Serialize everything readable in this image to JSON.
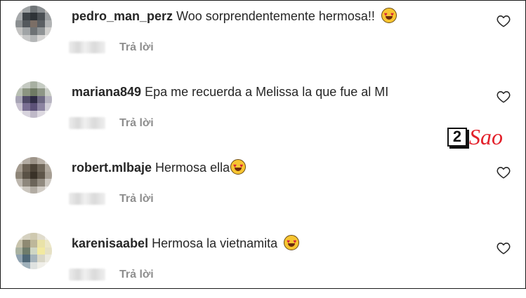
{
  "comments": [
    {
      "username": "pedro_man_perz",
      "text": "Woo sorprendentemente hermosa!!",
      "emoji": "heart-eyes-emoji",
      "reply_label": "Trả lời",
      "avatar_colors": [
        "#c9c6c4",
        "#9fa3a5",
        "#6f7477",
        "#8b8f92",
        "#bdbbb9",
        "#a6a9ab",
        "#3f4448",
        "#2f3438",
        "#4b5054",
        "#9c9fa1",
        "#8a8e90",
        "#54595d",
        "#7b6e66",
        "#5b5f63",
        "#b1b3b4",
        "#c3c3c2",
        "#a0a4a6",
        "#6e7275",
        "#8f9395",
        "#d2d1cf",
        "#e4e3e1",
        "#c7c8c8",
        "#b4b6b7",
        "#d6d5d4",
        "#ebeae8"
      ]
    },
    {
      "username": "mariana849",
      "text": "Epa me recuerda a Melissa la que fue al MI",
      "emoji": "",
      "reply_label": "Trả lời",
      "avatar_colors": [
        "#dadcd9",
        "#c5cac2",
        "#a8b0a2",
        "#c6ccc3",
        "#e6e7e5",
        "#b9c0b3",
        "#8c9581",
        "#6f7a64",
        "#8e9686",
        "#c9cdc5",
        "#a7a4b5",
        "#4f4a66",
        "#2e2b44",
        "#6d6882",
        "#b7b4c1",
        "#c8c2d0",
        "#7a6f93",
        "#5c5178",
        "#8c84a1",
        "#d2cfd8",
        "#eeeeee",
        "#d7d3dd",
        "#bfb9c8",
        "#dcd8e0",
        "#f1f1f1"
      ]
    },
    {
      "username": "robert.mlbaje",
      "text": "Hermosa ella",
      "emoji": "heart-eyes-emoji",
      "reply_label": "Trả lời",
      "avatar_colors": [
        "#d8d4cf",
        "#b3aca3",
        "#9d9489",
        "#b8b0a6",
        "#dcd8d3",
        "#a39a8e",
        "#6b6154",
        "#4d4438",
        "#6f6659",
        "#b0a89d",
        "#8d8578",
        "#5a5246",
        "#3a3228",
        "#5e5549",
        "#a69e93",
        "#bdb7ae",
        "#8e877c",
        "#6c655a",
        "#918a7f",
        "#cdc8c1",
        "#e6e3df",
        "#cbc6be",
        "#b2aca3",
        "#d1ccc5",
        "#ece9e6"
      ]
    },
    {
      "username": "karenisaabel",
      "text": "Hermosa la vietnamita",
      "emoji": "heart-eyes-emoji",
      "reply_label": "Trả lời",
      "avatar_colors": [
        "#e7e4d9",
        "#d5d1c0",
        "#cfc9b0",
        "#e0dccc",
        "#f0eee7",
        "#c9c4ad",
        "#8f8a73",
        "#bdb79a",
        "#e9e2a8",
        "#ece7c8",
        "#a9b2a1",
        "#6f7c6b",
        "#cfd6c4",
        "#f2e9a0",
        "#e6e1c4",
        "#8fa2b0",
        "#4f6877",
        "#a5b3bb",
        "#d9d7c7",
        "#ebe9de",
        "#c6cdd1",
        "#9fb0ba",
        "#dfe2e0",
        "#f0efe9",
        "#f7f6f2"
      ]
    }
  ],
  "watermark": {
    "number": "2",
    "text": "Sao"
  },
  "colors": {
    "username": "#262626",
    "reply": "#8e8e8e",
    "watermark_red": "#e3212b",
    "border": "#1a1a1a"
  }
}
